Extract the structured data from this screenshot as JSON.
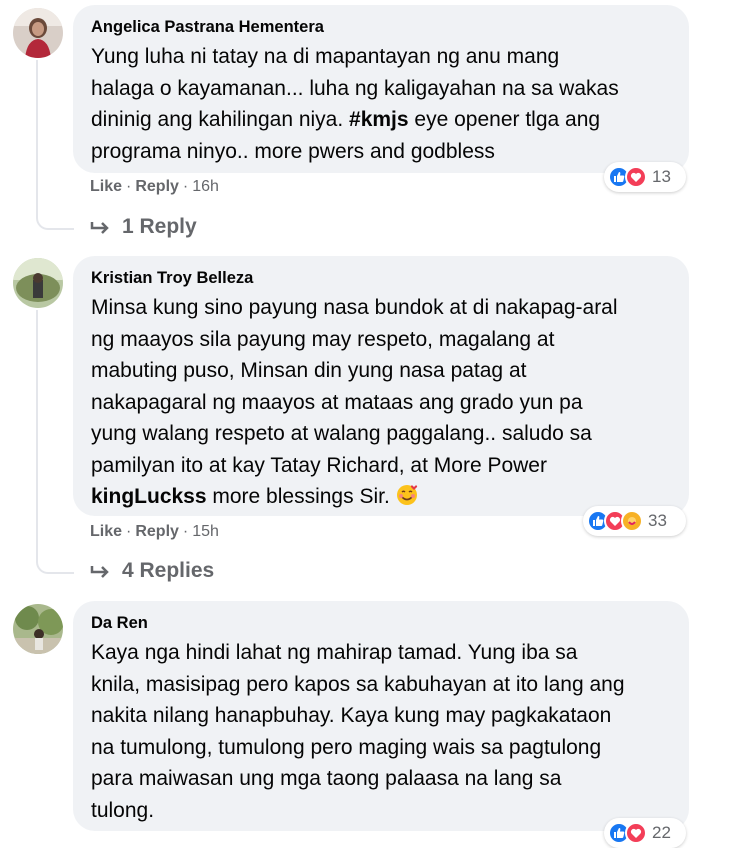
{
  "comments": [
    {
      "author": "Angelica Pastrana Hementera",
      "text_lines": [
        "Yung luha ni tatay na di mapantayan ng anu mang",
        "halaga o kayamanan... luha ng kaligayahan na sa wakas",
        "dininig ang kahilingan niya."
      ],
      "hashtag": "#kmjs",
      "text_after": " eye opener tlga ang\nprograma ninyo.. more pwers and godbless",
      "like_label": "Like",
      "reply_label": "Reply",
      "time": "16h",
      "reaction_count": "13",
      "reactions": [
        "like-icon",
        "love-icon"
      ],
      "view_replies": "1 Reply"
    },
    {
      "author": "Kristian Troy Belleza",
      "text": "Minsa kung sino payung nasa bundok at di nakapag-aral\nng maayos sila payung may respeto, magalang at\nmabuting puso, Minsan din yung nasa patag at\nnakapagaral ng maayos at mataas ang grado yun pa\nyung walang respeto at walang paggalang.. saludo sa\npamilyan ito at kay Tatay Richard, at More Power",
      "mention": "kingLuckss",
      "text_after": " more blessings Sir.",
      "emoji": "smiling-face-with-hearts",
      "like_label": "Like",
      "reply_label": "Reply",
      "time": "15h",
      "reaction_count": "33",
      "reactions": [
        "like-icon",
        "love-icon",
        "care-icon"
      ],
      "view_replies": "4 Replies"
    },
    {
      "author": "Da Ren",
      "text": "Kaya nga hindi lahat ng mahirap tamad. Yung iba sa\nknila, masisipag pero kapos sa kabuhayan at ito lang ang\nnakita nilang hanapbuhay. Kaya kung may pagkakataon\nna tumulong, tumulong pero maging wais sa pagtulong\npara maiwasan ung mga taong palaasa na lang sa\ntulong.",
      "reaction_count": "22"
    }
  ],
  "separator": "·",
  "colors": {
    "bubble": "#f0f2f5",
    "meta": "#65676b",
    "like": "#1877f2",
    "love": "#f33e58",
    "care": "#f7b125"
  }
}
